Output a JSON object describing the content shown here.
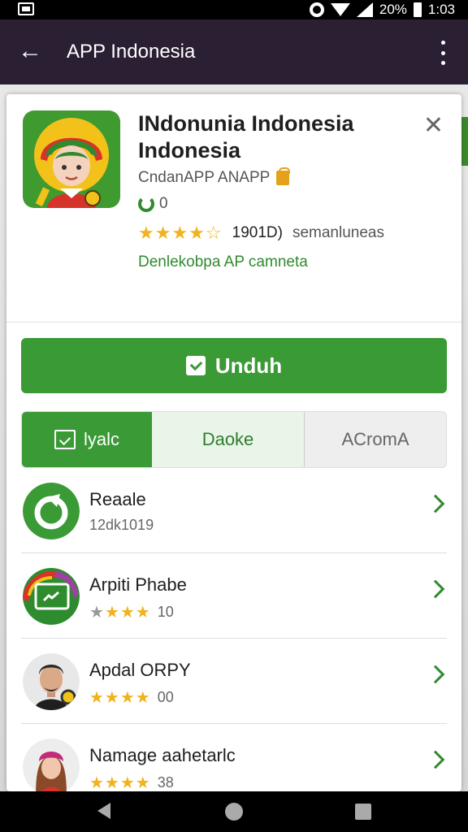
{
  "status_bar": {
    "battery": "20%",
    "time": "1:03"
  },
  "app_bar": {
    "title": "APP Indonesia"
  },
  "app": {
    "name": "INdonunia Indonesia Indonesia",
    "developer": "CndanAPP ANAPP",
    "downloads": "0",
    "rating": {
      "stars": 4,
      "count": "1901D)",
      "label": "semanluneas"
    },
    "category": "Denlekobpa AP camneta"
  },
  "install_button": {
    "label": "Unduh"
  },
  "tabs": [
    {
      "label": "lyalc",
      "active": true
    },
    {
      "label": "Daoke"
    },
    {
      "label": "ACromA"
    }
  ],
  "list": [
    {
      "title": "Reaale",
      "subtitle": "12dk1019",
      "icon": "refresh-badge-icon"
    },
    {
      "title": "Arpiti Phabe",
      "rating": "10",
      "stars": 4,
      "icon": "screen-app-icon"
    },
    {
      "title": "Apdal ORPY",
      "rating": "00",
      "stars": 4,
      "icon": "man-avatar"
    },
    {
      "title": "Namage aahetarlc",
      "rating": "38",
      "stars": 4,
      "icon": "woman-avatar"
    }
  ],
  "colors": {
    "accent": "#3a9a35",
    "appbar": "#2b1f34",
    "star": "#f1b21d"
  }
}
